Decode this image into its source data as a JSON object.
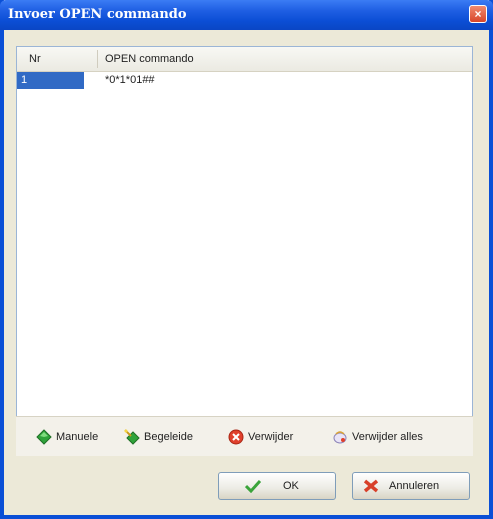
{
  "window": {
    "title": "Invoer OPEN commando",
    "close_glyph": "×"
  },
  "list": {
    "columns": [
      "Nr",
      "OPEN commando"
    ],
    "rows": [
      {
        "nr": "1",
        "open_commando": "*0*1*01##"
      }
    ]
  },
  "toolbar": {
    "items": [
      {
        "label": "Manuele",
        "icon": "green-diamond-icon"
      },
      {
        "label": "Begeleide",
        "icon": "wand-diamond-icon"
      },
      {
        "label": "Verwijder",
        "icon": "red-delete-icon"
      },
      {
        "label": "Verwijder alles",
        "icon": "clear-all-icon"
      }
    ]
  },
  "buttons": {
    "ok_label": "OK",
    "cancel_label": "Annuleren"
  },
  "colors": {
    "title_bar": "#0b4ed5",
    "selection": "#316ac5",
    "dialog_bg": "#ece9d8"
  }
}
